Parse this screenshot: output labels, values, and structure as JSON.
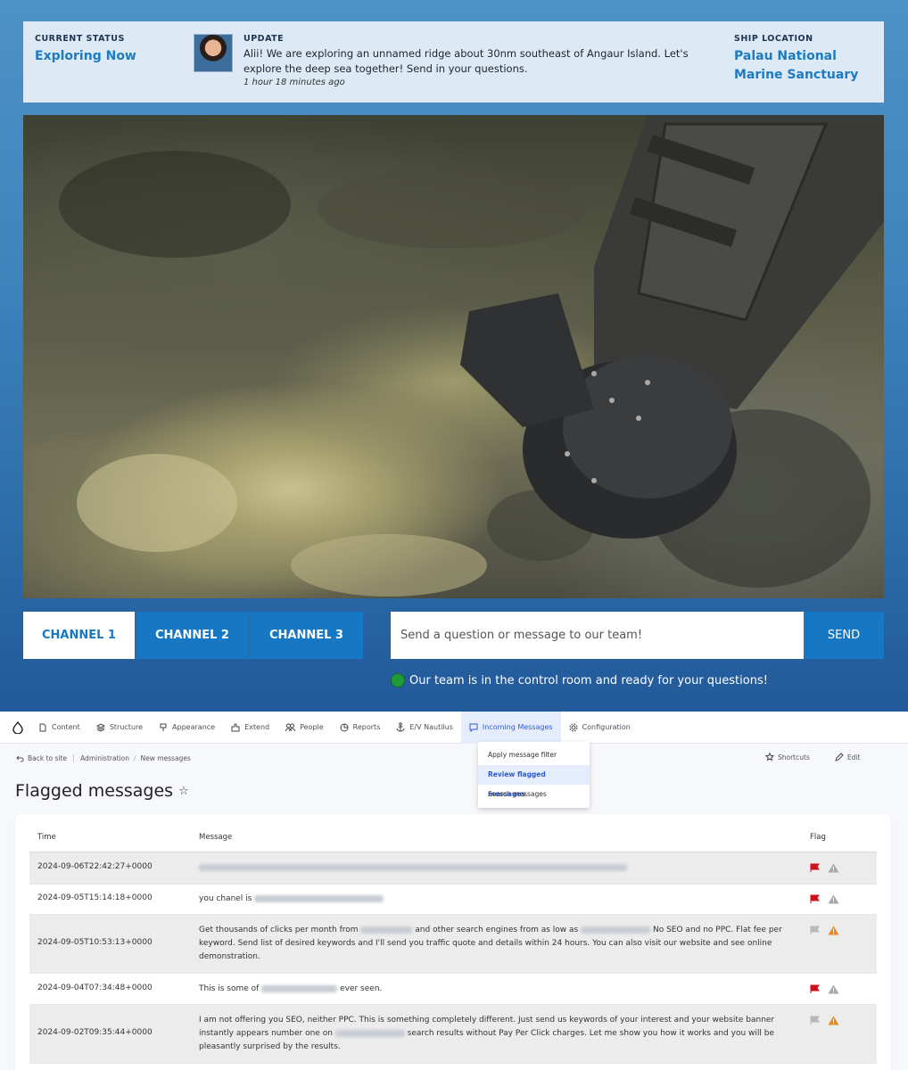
{
  "status": {
    "current_label": "CURRENT STATUS",
    "current_value": "Exploring Now",
    "update_label": "UPDATE",
    "update_text": "Alii! We are exploring an unnamed ridge about 30nm southeast of Angaur Island. Let's explore the deep sea together! Send in your questions.",
    "update_time": "1 hour 18 minutes ago",
    "ship_label": "SHIP LOCATION",
    "ship_value": "Palau National Marine Sanctuary"
  },
  "channels": [
    "CHANNEL 1",
    "CHANNEL 2",
    "CHANNEL 3"
  ],
  "message": {
    "placeholder": "Send a question or message to our team!",
    "send_label": "SEND",
    "ready_text": "Our team is in the control room and ready for your questions!"
  },
  "toolbar": {
    "items": [
      "Content",
      "Structure",
      "Appearance",
      "Extend",
      "People",
      "Reports",
      "E/V Nautilus",
      "Incoming Messages",
      "Configuration"
    ],
    "dropdown": [
      "Apply message filter",
      "Review flagged messages",
      "Search messages"
    ]
  },
  "breadcrumb": {
    "back": "Back to site",
    "items": [
      "Administration",
      "New messages"
    ],
    "shortcuts": "Shortcuts",
    "edit": "Edit"
  },
  "page_title": "Flagged messages",
  "table": {
    "headers": {
      "time": "Time",
      "message": "Message",
      "flag": "Flag"
    },
    "rows": [
      {
        "time": "2024-09-06T22:42:27+0000",
        "flagged": true
      },
      {
        "time": "2024-09-05T15:14:18+0000",
        "msg_a": "you chanel is",
        "flagged": true
      },
      {
        "time": "2024-09-05T10:53:13+0000",
        "msg_a": "Get thousands of clicks per month from",
        "msg_b": "and other search engines from as low as",
        "msg_c": "No SEO and no PPC. Flat fee per keyword. Send list of desired keywords and I'll send you traffic quote and details within 24 hours. You can also visit our website and see online demonstration.",
        "flagged": false
      },
      {
        "time": "2024-09-04T07:34:48+0000",
        "msg_a": "This is some of",
        "msg_b": "ever seen.",
        "flagged": true
      },
      {
        "time": "2024-09-02T09:35:44+0000",
        "msg_a": "I am not offering you SEO, neither PPC. This is something completely different. Just send us keywords of your interest and your website banner instantly appears number one on",
        "msg_b": "search results without Pay Per Click charges. Let me show you how it works and you will be pleasantly surprised by the results.",
        "flagged": false
      }
    ]
  },
  "colors": {
    "accent": "#1677c5",
    "flag_red": "#d0111b",
    "warn_orange": "#e8891c"
  }
}
